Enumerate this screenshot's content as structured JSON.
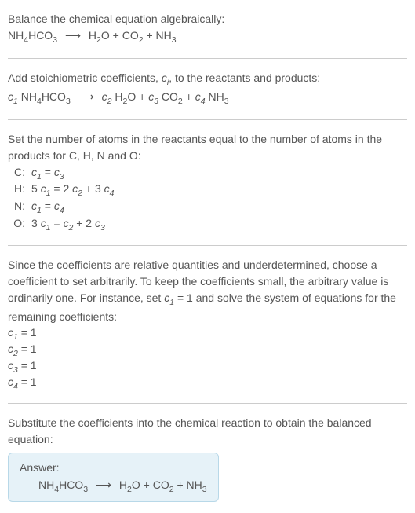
{
  "section1": {
    "title": "Balance the chemical equation algebraically:",
    "reactant": "NH",
    "r_sub1": "4",
    "r_mid": "HCO",
    "r_sub2": "3",
    "arrow": "⟶",
    "p1": "H",
    "p1_sub": "2",
    "p1b": "O",
    "plus1": " + ",
    "p2": "CO",
    "p2_sub": "2",
    "plus2": " + ",
    "p3": "NH",
    "p3_sub": "3"
  },
  "section2": {
    "title_a": "Add stoichiometric coefficients, ",
    "ci": "c",
    "ci_sub": "i",
    "title_b": ", to the reactants and products:",
    "c1": "c",
    "c1_sub": "1",
    "sp1": " NH",
    "sp1_sub": "4",
    "sp1b": "HCO",
    "sp1b_sub": "3",
    "arrow": "⟶",
    "c2": "c",
    "c2_sub": "2",
    "sp2": " H",
    "sp2_sub": "2",
    "sp2b": "O",
    "plus1": " + ",
    "c3": "c",
    "c3_sub": "3",
    "sp3": " CO",
    "sp3_sub": "2",
    "plus2": " + ",
    "c4": "c",
    "c4_sub": "4",
    "sp4": " NH",
    "sp4_sub": "3"
  },
  "section3": {
    "title": "Set the number of atoms in the reactants equal to the number of atoms in the products for C, H, N and O:",
    "rows": [
      {
        "label": "C:",
        "lhs_c": "c",
        "lhs_sub": "1",
        "eq": " = ",
        "rhs_c": "c",
        "rhs_sub": "3"
      },
      {
        "label": "H:",
        "lhs_pre": "5 ",
        "lhs_c": "c",
        "lhs_sub": "1",
        "eq": " = 2 ",
        "rhs_c": "c",
        "rhs_sub": "2",
        "plus": " + 3 ",
        "rhs2_c": "c",
        "rhs2_sub": "4"
      },
      {
        "label": "N:",
        "lhs_c": "c",
        "lhs_sub": "1",
        "eq": " = ",
        "rhs_c": "c",
        "rhs_sub": "4"
      },
      {
        "label": "O:",
        "lhs_pre": "3 ",
        "lhs_c": "c",
        "lhs_sub": "1",
        "eq": " = ",
        "rhs_c": "c",
        "rhs_sub": "2",
        "plus": " + 2 ",
        "rhs2_c": "c",
        "rhs2_sub": "3"
      }
    ]
  },
  "section4": {
    "text_a": "Since the coefficients are relative quantities and underdetermined, choose a coefficient to set arbitrarily. To keep the coefficients small, the arbitrary value is ordinarily one. For instance, set ",
    "cvar": "c",
    "cvar_sub": "1",
    "text_b": " = 1 and solve the system of equations for the remaining coefficients:",
    "lines": [
      {
        "c": "c",
        "sub": "1",
        "val": " = 1"
      },
      {
        "c": "c",
        "sub": "2",
        "val": " = 1"
      },
      {
        "c": "c",
        "sub": "3",
        "val": " = 1"
      },
      {
        "c": "c",
        "sub": "4",
        "val": " = 1"
      }
    ]
  },
  "section5": {
    "title": "Substitute the coefficients into the chemical reaction to obtain the balanced equation:",
    "answer_label": "Answer:",
    "reactant": "NH",
    "r_sub1": "4",
    "r_mid": "HCO",
    "r_sub2": "3",
    "arrow": "⟶",
    "p1": "H",
    "p1_sub": "2",
    "p1b": "O",
    "plus1": " + ",
    "p2": "CO",
    "p2_sub": "2",
    "plus2": " + ",
    "p3": "NH",
    "p3_sub": "3"
  }
}
